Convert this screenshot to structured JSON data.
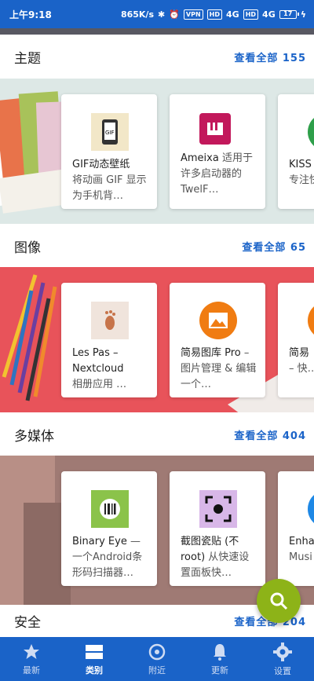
{
  "status_bar": {
    "time": "上午9:18",
    "network_speed": "865K/s",
    "vpn": "VPN",
    "hd1": "HD",
    "sig1": "4G",
    "hd2": "HD",
    "sig2": "4G",
    "battery": "17"
  },
  "sections": [
    {
      "title": "主题",
      "see_all": "查看全部 155",
      "cards": [
        {
          "name": "GIF动态壁纸",
          "desc": "将动画 GIF 显示为手机背…"
        },
        {
          "name": "Ameixa",
          "desc": "适用于许多启动器的 TwelF…"
        },
        {
          "name": "KISS",
          "desc": "专注快速"
        }
      ]
    },
    {
      "title": "图像",
      "see_all": "查看全部 65",
      "cards": [
        {
          "name": "Les Pas – Nextcloud",
          "desc": "相册应用 …"
        },
        {
          "name": "简易图库 Pro",
          "desc": "– 图片管理 & 编辑 一个…"
        },
        {
          "name": "简易",
          "desc": "– 快… 的画"
        }
      ]
    },
    {
      "title": "多媒体",
      "see_all": "查看全部 404",
      "cards": [
        {
          "name": "Binary Eye",
          "desc": "— 一个Android条形码扫描器…"
        },
        {
          "name": "截图瓷贴 (不 root)",
          "desc": "从快速设置面板快…"
        },
        {
          "name": "Enha",
          "desc": "Musi Conf"
        }
      ]
    },
    {
      "title": "安全",
      "see_all": "查看全部 204"
    }
  ],
  "bottom_nav": [
    {
      "label": "最新",
      "icon": "star-icon"
    },
    {
      "label": "类别",
      "icon": "categories-icon"
    },
    {
      "label": "附近",
      "icon": "nearby-icon"
    },
    {
      "label": "更新",
      "icon": "bell-icon"
    },
    {
      "label": "设置",
      "icon": "gear-icon"
    }
  ],
  "fab": {
    "icon": "search-icon"
  },
  "colors": {
    "primary": "#1a63c8",
    "fab": "#8db318",
    "band_themes": "#dde8e6",
    "band_images": "#e8535a",
    "band_media": "#9f7a74"
  }
}
